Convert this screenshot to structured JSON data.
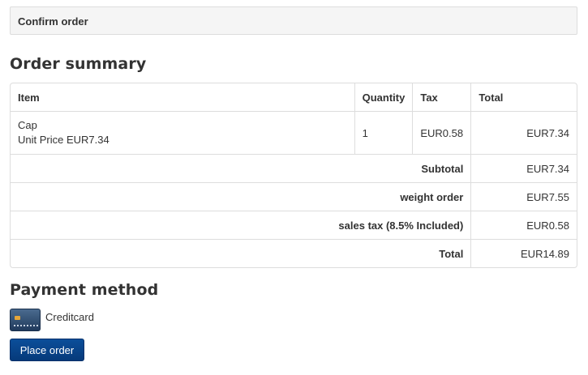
{
  "header": {
    "title": "Confirm order"
  },
  "order_summary": {
    "title": "Order summary",
    "columns": {
      "item": "Item",
      "quantity": "Quantity",
      "tax": "Tax",
      "total": "Total"
    },
    "items": [
      {
        "name": "Cap",
        "unit_price": "Unit Price EUR7.34",
        "quantity": "1",
        "tax": "EUR0.58",
        "total": "EUR7.34"
      }
    ],
    "summary": [
      {
        "label": "Subtotal",
        "value": "EUR7.34"
      },
      {
        "label": "weight order",
        "value": "EUR7.55"
      },
      {
        "label": "sales tax (8.5% Included)",
        "value": "EUR0.58"
      },
      {
        "label": "Total",
        "value": "EUR14.89"
      }
    ]
  },
  "payment": {
    "title": "Payment method",
    "method_label": "Creditcard",
    "method_icon": "credit-card-icon"
  },
  "actions": {
    "place_order_label": "Place order"
  },
  "colors": {
    "button_bg": "#0b4e9a",
    "header_bg": "#f5f5f5",
    "border": "#dddddd",
    "text": "#333333"
  }
}
